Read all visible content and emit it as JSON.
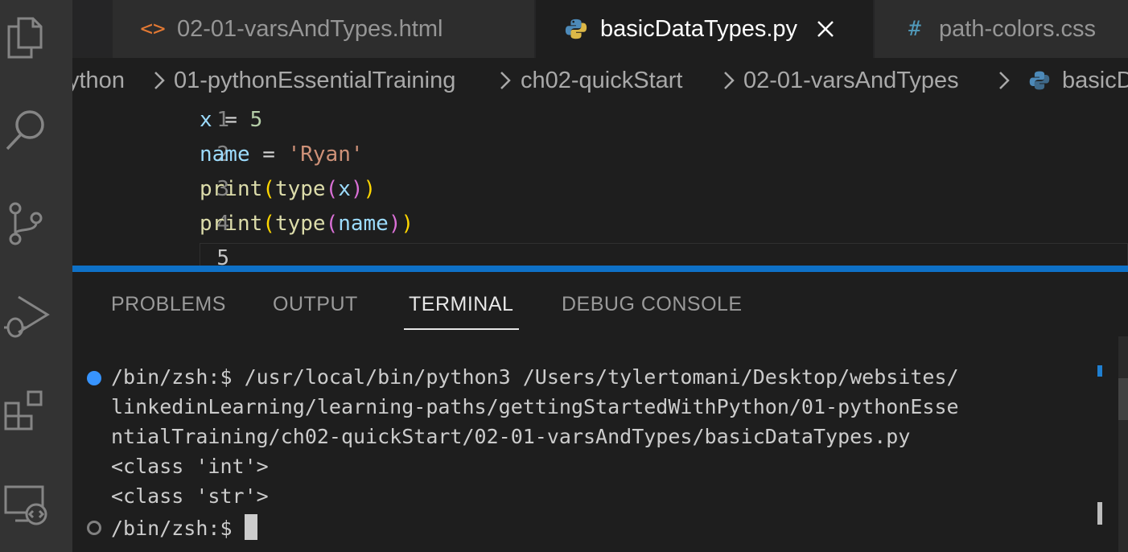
{
  "activity_bar": {
    "icons": [
      "explorer-icon",
      "search-icon",
      "source-control-icon",
      "run-debug-icon",
      "extensions-icon",
      "remote-explorer-icon"
    ]
  },
  "tabs": [
    {
      "label": "02-01-varsAndTypes.html",
      "icon": "<>",
      "icon_color": "#e37933",
      "active": false
    },
    {
      "label": "basicDataTypes.py",
      "icon": "python-icon",
      "active": true
    },
    {
      "label": "path-colors.css",
      "icon": "#",
      "icon_color": "#519aba",
      "active": false
    }
  ],
  "breadcrumb": {
    "items": [
      "ython",
      "01-pythonEssentialTraining",
      "ch02-quickStart",
      "02-01-varsAndTypes",
      "basicD"
    ]
  },
  "editor": {
    "line_numbers": [
      "1",
      "2",
      "3",
      "4",
      "5"
    ],
    "lines": [
      {
        "tokens": [
          {
            "t": "x",
            "c": "c-var"
          },
          {
            "t": " = ",
            "c": "c-op"
          },
          {
            "t": "5",
            "c": "c-num"
          }
        ]
      },
      {
        "tokens": [
          {
            "t": "name",
            "c": "c-var"
          },
          {
            "t": " = ",
            "c": "c-op"
          },
          {
            "t": "'Ryan'",
            "c": "c-str"
          }
        ]
      },
      {
        "tokens": [
          {
            "t": "print",
            "c": "c-fn"
          },
          {
            "t": "(",
            "c": "b1"
          },
          {
            "t": "type",
            "c": "c-fn"
          },
          {
            "t": "(",
            "c": "b2"
          },
          {
            "t": "x",
            "c": "c-var"
          },
          {
            "t": ")",
            "c": "b2"
          },
          {
            "t": ")",
            "c": "b1"
          }
        ]
      },
      {
        "tokens": [
          {
            "t": "print",
            "c": "c-fn"
          },
          {
            "t": "(",
            "c": "b1"
          },
          {
            "t": "type",
            "c": "c-fn"
          },
          {
            "t": "(",
            "c": "b2"
          },
          {
            "t": "name",
            "c": "c-var"
          },
          {
            "t": ")",
            "c": "b2"
          },
          {
            "t": ")",
            "c": "b1"
          }
        ]
      }
    ]
  },
  "panel": {
    "tabs": [
      "PROBLEMS",
      "OUTPUT",
      "TERMINAL",
      "DEBUG CONSOLE"
    ],
    "active_tab": "TERMINAL"
  },
  "terminal": {
    "lines": [
      "/bin/zsh:$ /usr/local/bin/python3 /Users/tylertomani/Desktop/websites/",
      "linkedinLearning/learning-paths/gettingStartedWithPython/01-pythonEsse",
      "ntialTraining/ch02-quickStart/02-01-varsAndTypes/basicDataTypes.py",
      "<class 'int'>",
      "<class 'str'>",
      "/bin/zsh:$ "
    ]
  },
  "colors": {
    "accent": "#0e71c7",
    "dot_success": "#3794ff"
  }
}
